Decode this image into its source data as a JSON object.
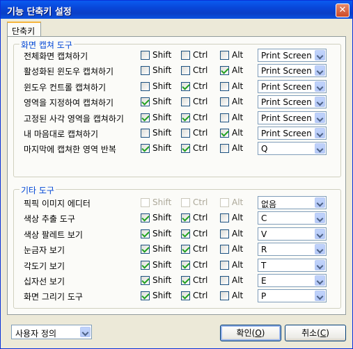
{
  "window": {
    "title": "기능 단축키 설정",
    "close_glyph": "✕"
  },
  "tab": {
    "label": "단축키"
  },
  "capture_group": {
    "title": "화면 캡쳐 도구",
    "rows": [
      {
        "label": "전체화면 캡쳐하기",
        "shift": false,
        "ctrl": false,
        "alt": false,
        "key": "Print Screen"
      },
      {
        "label": "활성화된 윈도우 캡쳐하기",
        "shift": false,
        "ctrl": false,
        "alt": true,
        "key": "Print Screen"
      },
      {
        "label": "윈도우 컨트롤 캡쳐하기",
        "shift": false,
        "ctrl": true,
        "alt": false,
        "key": "Print Screen"
      },
      {
        "label": "영역을 지정하여 캡쳐하기",
        "shift": true,
        "ctrl": false,
        "alt": false,
        "key": "Print Screen"
      },
      {
        "label": "고정된 사각 영역을 캡쳐하기",
        "shift": true,
        "ctrl": true,
        "alt": false,
        "key": "Print Screen"
      },
      {
        "label": "내 마음대로 캡쳐하기",
        "shift": false,
        "ctrl": false,
        "alt": true,
        "key": "Print Screen"
      },
      {
        "label": "마지막에 캡쳐한 영역 반복",
        "shift": true,
        "ctrl": true,
        "alt": false,
        "key": "Q"
      }
    ]
  },
  "other_group": {
    "title": "기타 도구",
    "rows": [
      {
        "label": "픽픽 이미지 에디터",
        "shift": false,
        "ctrl": false,
        "alt": false,
        "key": "없음",
        "disabled": true
      },
      {
        "label": "색상 추출 도구",
        "shift": true,
        "ctrl": true,
        "alt": false,
        "key": "C"
      },
      {
        "label": "색상 팔레트 보기",
        "shift": true,
        "ctrl": true,
        "alt": false,
        "key": "V"
      },
      {
        "label": "눈금자 보기",
        "shift": true,
        "ctrl": true,
        "alt": false,
        "key": "R"
      },
      {
        "label": "각도기 보기",
        "shift": true,
        "ctrl": true,
        "alt": false,
        "key": "T"
      },
      {
        "label": "십자선 보기",
        "shift": true,
        "ctrl": true,
        "alt": false,
        "key": "E"
      },
      {
        "label": "화면 그리기 도구",
        "shift": true,
        "ctrl": true,
        "alt": false,
        "key": "P"
      }
    ]
  },
  "modifiers": {
    "shift": "Shift",
    "ctrl": "Ctrl",
    "alt": "Alt"
  },
  "footer": {
    "profile_value": "사용자 정의",
    "ok_label": "확인(",
    "ok_key": "O",
    "ok_suffix": ")",
    "cancel_label": "취소(",
    "cancel_key": "C",
    "cancel_suffix": ")"
  },
  "colors": {
    "title_bar": "#0a52e0",
    "group_title": "#0046d5",
    "checkmark": "#21a121"
  }
}
